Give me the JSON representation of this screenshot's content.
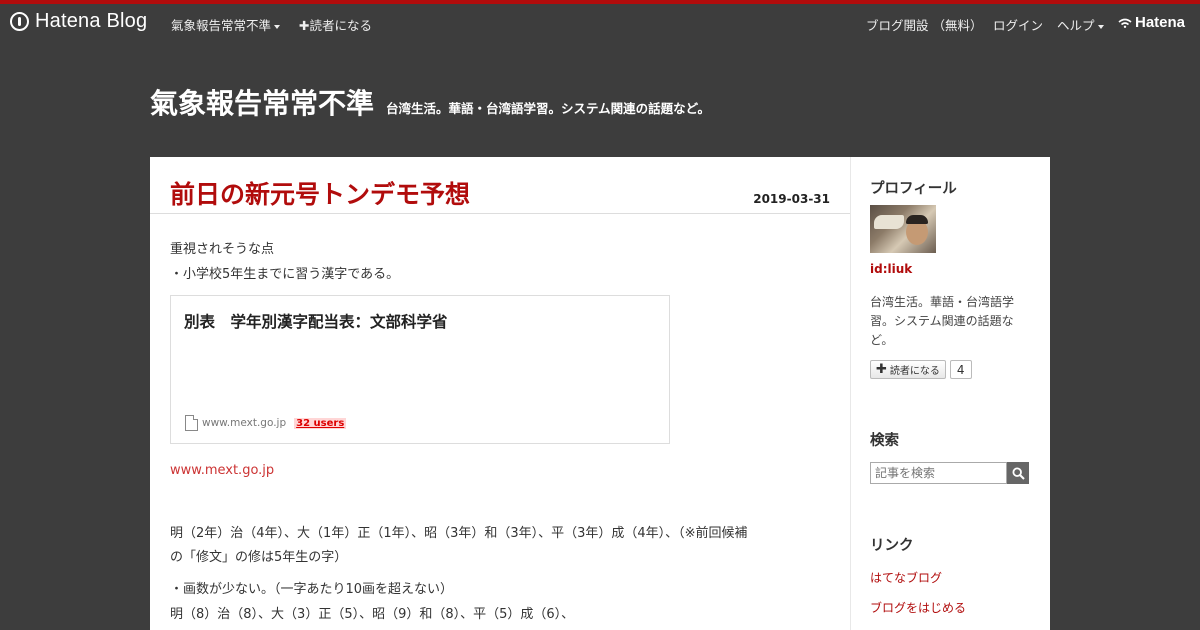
{
  "colors": {
    "accent": "#b10c0c",
    "background": "#3d3d3d",
    "content_bg": "#ffffff"
  },
  "navbar": {
    "logo_text": "Hatena Blog",
    "blog_menu": "氣象報告常常不準",
    "subscribe": "✚読者になる",
    "open_blog": "ブログ開設 （無料）",
    "login": "ログイン",
    "help": "ヘルプ",
    "brand": "Hatena"
  },
  "blog": {
    "title": "氣象報告常常不準",
    "description": "台湾生活。華語・台湾語学習。システム関連の話題など。"
  },
  "entry": {
    "title": "前日の新元号トンデモ予想",
    "date": "2019-03-31",
    "para1": "重視されそうな点",
    "para2": "・小学校5年生までに習う漢字である。",
    "embed": {
      "title": "別表　学年別漢字配当表：文部科学省",
      "domain": "www.mext.go.jp",
      "users": "32 users"
    },
    "link": "www.mext.go.jp",
    "para3_line1": "明（2年）治（4年）、大（1年）正（1年）、昭（3年）和（3年）、平（3年）成（4年）、（※前回候補",
    "para3_line2": "の「修文」の修は5年生の字）",
    "para4": "・画数が少ない。（一字あたり10画を超えない）",
    "para5": "明（8）治（8）、大（3）正（5）、昭（9）和（8）、平（5）成（6）、"
  },
  "sidebar": {
    "profile_heading": "プロフィール",
    "user_id": "id:liuk",
    "user_desc": "台湾生活。華語・台湾語学習。システム関連の話題など。",
    "subscribe_label": "読者になる",
    "subscriber_count": "4",
    "search_heading": "検索",
    "search_placeholder": "記事を検索",
    "links_heading": "リンク",
    "links": [
      "はてなブログ",
      "ブログをはじめる"
    ]
  }
}
